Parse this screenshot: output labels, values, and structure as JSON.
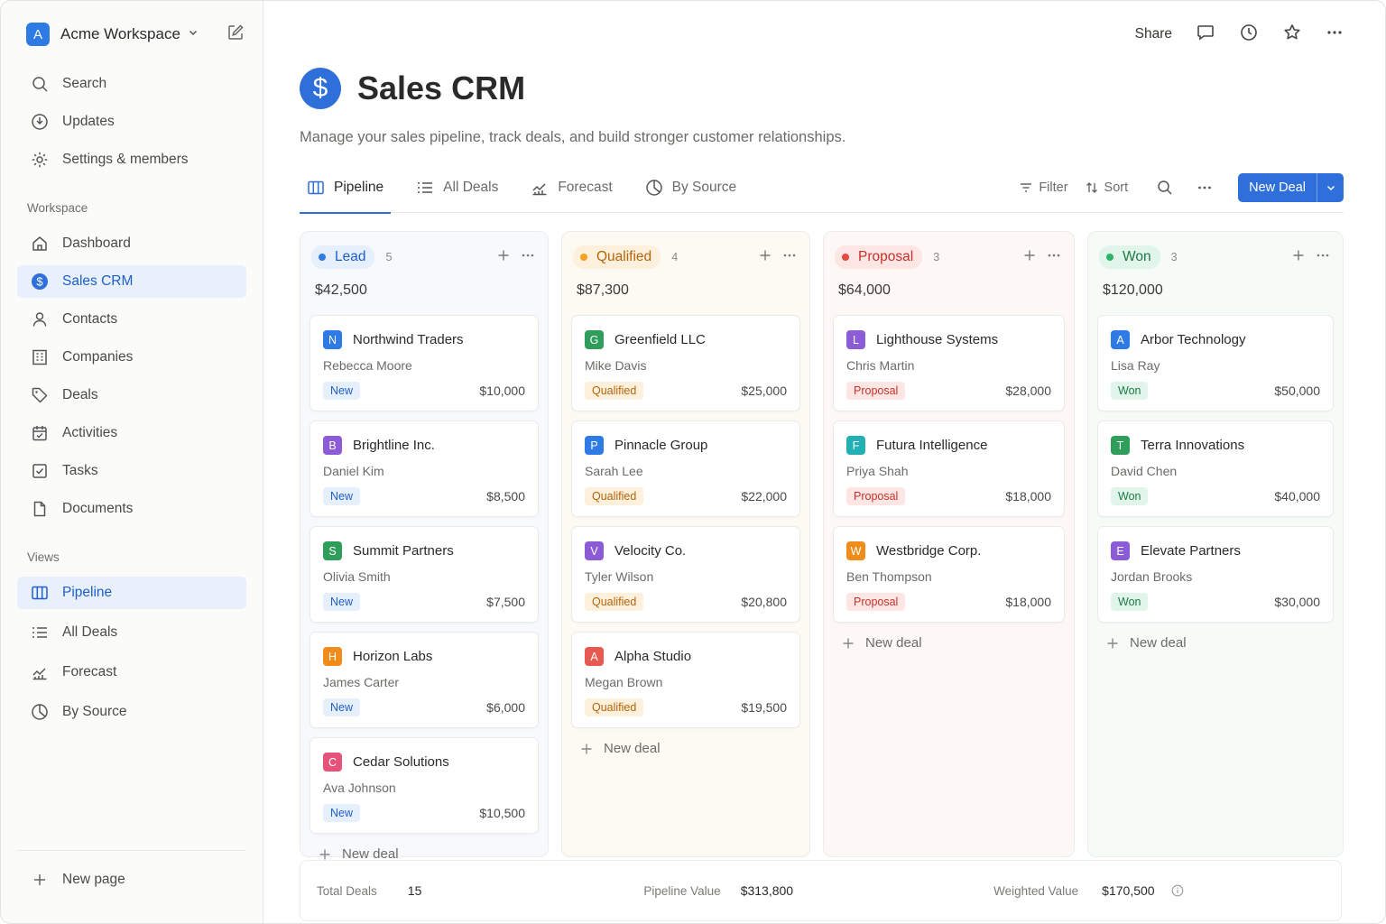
{
  "workspace": {
    "initial": "A",
    "name": "Acme Workspace"
  },
  "sidebar": {
    "top": [
      {
        "label": "Search",
        "icon": "search-icon"
      },
      {
        "label": "Updates",
        "icon": "updates-icon"
      },
      {
        "label": "Settings & members",
        "icon": "gear-icon"
      }
    ],
    "workspace_label": "Workspace",
    "workspace_items": [
      {
        "label": "Dashboard",
        "icon": "home-icon"
      },
      {
        "label": "Sales CRM",
        "icon": "dollar-icon",
        "active": true
      },
      {
        "label": "Contacts",
        "icon": "person-icon"
      },
      {
        "label": "Companies",
        "icon": "building-icon"
      },
      {
        "label": "Deals",
        "icon": "tag-icon"
      },
      {
        "label": "Activities",
        "icon": "calendar-icon"
      },
      {
        "label": "Tasks",
        "icon": "checkbox-icon"
      },
      {
        "label": "Documents",
        "icon": "document-icon"
      }
    ],
    "views_label": "Views",
    "views_items": [
      {
        "label": "Pipeline",
        "icon": "board-icon",
        "active": true
      },
      {
        "label": "All Deals",
        "icon": "list-icon"
      },
      {
        "label": "Forecast",
        "icon": "chart-icon"
      },
      {
        "label": "By Source",
        "icon": "pie-icon"
      }
    ],
    "new_page": "New page"
  },
  "topbar": {
    "share": "Share"
  },
  "page": {
    "icon": "$",
    "title": "Sales CRM",
    "subtitle": "Manage your sales pipeline, track deals, and build stronger customer relationships."
  },
  "tabs": [
    {
      "label": "Pipeline",
      "icon": "board-icon",
      "active": true
    },
    {
      "label": "All Deals",
      "icon": "list-icon"
    },
    {
      "label": "Forecast",
      "icon": "chart-icon"
    },
    {
      "label": "By Source",
      "icon": "pie-icon"
    }
  ],
  "toolbar": {
    "filter": "Filter",
    "sort": "Sort",
    "new_deal": "New Deal"
  },
  "columns": [
    {
      "name": "Lead",
      "count": "5",
      "total": "$42,500",
      "dot": "#2f7be5",
      "pill_bg": "#e6effc",
      "pill_fg": "#1f5fc9",
      "col_bg": "#f7f9fd",
      "tag_bg": "#e6effc",
      "tag_fg": "#1f5fc9",
      "deals": [
        {
          "initial": "N",
          "color": "#2f7be5",
          "company": "Northwind Traders",
          "person": "Rebecca Moore",
          "stage": "New",
          "amount": "$10,000"
        },
        {
          "initial": "B",
          "color": "#8b5cd6",
          "company": "Brightline Inc.",
          "person": "Daniel Kim",
          "stage": "New",
          "amount": "$8,500"
        },
        {
          "initial": "S",
          "color": "#2f9e5a",
          "company": "Summit Partners",
          "person": "Olivia Smith",
          "stage": "New",
          "amount": "$7,500"
        },
        {
          "initial": "H",
          "color": "#f08c1a",
          "company": "Horizon Labs",
          "person": "James Carter",
          "stage": "New",
          "amount": "$6,000"
        },
        {
          "initial": "C",
          "color": "#e5527a",
          "company": "Cedar Solutions",
          "person": "Ava Johnson",
          "stage": "New",
          "amount": "$10,500"
        }
      ],
      "new_deal": "New deal"
    },
    {
      "name": "Qualified",
      "count": "4",
      "total": "$87,300",
      "dot": "#f2a21c",
      "pill_bg": "#fdf0dc",
      "pill_fg": "#b5650a",
      "col_bg": "#fdf9f3",
      "tag_bg": "#fdf0dc",
      "tag_fg": "#b5650a",
      "deals": [
        {
          "initial": "G",
          "color": "#2f9e5a",
          "company": "Greenfield LLC",
          "person": "Mike Davis",
          "stage": "Qualified",
          "amount": "$25,000"
        },
        {
          "initial": "P",
          "color": "#2f7be5",
          "company": "Pinnacle Group",
          "person": "Sarah Lee",
          "stage": "Qualified",
          "amount": "$22,000"
        },
        {
          "initial": "V",
          "color": "#8b5cd6",
          "company": "Velocity Co.",
          "person": "Tyler Wilson",
          "stage": "Qualified",
          "amount": "$20,800"
        },
        {
          "initial": "A",
          "color": "#e85a4f",
          "company": "Alpha Studio",
          "person": "Megan Brown",
          "stage": "Qualified",
          "amount": "$19,500"
        }
      ],
      "new_deal": "New deal"
    },
    {
      "name": "Proposal",
      "count": "3",
      "total": "$64,000",
      "dot": "#e5483d",
      "pill_bg": "#fde6e4",
      "pill_fg": "#c6322a",
      "col_bg": "#fdf7f6",
      "tag_bg": "#fde6e4",
      "tag_fg": "#c6322a",
      "deals": [
        {
          "initial": "L",
          "color": "#8b5cd6",
          "company": "Lighthouse Systems",
          "person": "Chris Martin",
          "stage": "Proposal",
          "amount": "$28,000"
        },
        {
          "initial": "F",
          "color": "#22b0b5",
          "company": "Futura Intelligence",
          "person": "Priya Shah",
          "stage": "Proposal",
          "amount": "$18,000"
        },
        {
          "initial": "W",
          "color": "#f08c1a",
          "company": "Westbridge Corp.",
          "person": "Ben Thompson",
          "stage": "Proposal",
          "amount": "$18,000"
        }
      ],
      "new_deal": "New deal"
    },
    {
      "name": "Won",
      "count": "3",
      "total": "$120,000",
      "dot": "#2fb36a",
      "pill_bg": "#e2f5ea",
      "pill_fg": "#1d7a45",
      "col_bg": "#f6fbf8",
      "tag_bg": "#e2f5ea",
      "tag_fg": "#1d7a45",
      "deals": [
        {
          "initial": "A",
          "color": "#2f7be5",
          "company": "Arbor Technology",
          "person": "Lisa Ray",
          "stage": "Won",
          "amount": "$50,000"
        },
        {
          "initial": "T",
          "color": "#2f9e5a",
          "company": "Terra Innovations",
          "person": "David Chen",
          "stage": "Won",
          "amount": "$40,000"
        },
        {
          "initial": "E",
          "color": "#8b5cd6",
          "company": "Elevate Partners",
          "person": "Jordan Brooks",
          "stage": "Won",
          "amount": "$30,000"
        }
      ],
      "new_deal": "New deal"
    }
  ],
  "footer": {
    "total_label": "Total Deals",
    "total_value": "15",
    "pipeline_label": "Pipeline Value",
    "pipeline_value": "$313,800",
    "weighted_label": "Weighted Value",
    "weighted_value": "$170,500"
  }
}
